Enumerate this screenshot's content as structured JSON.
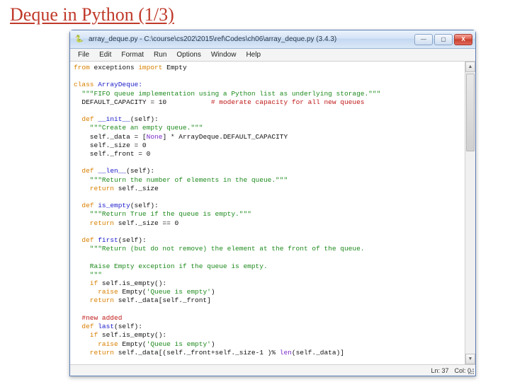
{
  "slide": {
    "title": "Deque in Python (1/3)"
  },
  "window": {
    "title": "array_deque.py - C:\\course\\cs202\\2015\\ref\\Codes\\ch06\\array_deque.py (3.4.3)",
    "buttons": {
      "min": "—",
      "max": "▢",
      "close": "X"
    }
  },
  "menu": {
    "items": [
      "File",
      "Edit",
      "Format",
      "Run",
      "Options",
      "Window",
      "Help"
    ]
  },
  "status": {
    "ln_label": "Ln: ",
    "ln": "37",
    "col_label": "Col: ",
    "col": "0"
  },
  "scroll": {
    "up": "▲",
    "down": "▼"
  },
  "code": {
    "l1a": "from",
    "l1b": " exceptions ",
    "l1c": "import",
    "l1d": " Empty",
    "l3a": "class",
    "l3b": " ArrayDeque:",
    "l4": "  \"\"\"FIFO queue implementation using a Python list as underlying storage.\"\"\"",
    "l5a": "  DEFAULT_CAPACITY = 10           ",
    "l5b": "# moderate capacity for all new queues",
    "l7a": "  def",
    "l7b": " __init__",
    "l7c": "(self):",
    "l8": "    \"\"\"Create an empty queue.\"\"\"",
    "l9a": "    self._data = [",
    "l9b": "None",
    "l9c": "] * ArrayDeque.DEFAULT_CAPACITY",
    "l10": "    self._size = 0",
    "l11": "    self._front = 0",
    "l13a": "  def",
    "l13b": " __len__",
    "l13c": "(self):",
    "l14": "    \"\"\"Return the number of elements in the queue.\"\"\"",
    "l15a": "    return",
    "l15b": " self._size",
    "l17a": "  def",
    "l17b": " is_empty",
    "l17c": "(self):",
    "l18": "    \"\"\"Return True if the queue is empty.\"\"\"",
    "l19a": "    return",
    "l19b": " self._size == 0",
    "l21a": "  def",
    "l21b": " first",
    "l21c": "(self):",
    "l22": "    \"\"\"Return (but do not remove) the element at the front of the queue.",
    "l23": "",
    "l24": "    Raise Empty exception if the queue is empty.",
    "l25": "    \"\"\"",
    "l26a": "    if",
    "l26b": " self.is_empty():",
    "l27a": "      raise",
    "l27b": " Empty(",
    "l27c": "'Queue is empty'",
    "l27d": ")",
    "l28a": "    return",
    "l28b": " self._data[self._front]",
    "l30": "  #new added",
    "l31a": "  def",
    "l31b": " last",
    "l31c": "(self):",
    "l32a": "    if",
    "l32b": " self.is_empty():",
    "l33a": "      raise",
    "l33b": " Empty(",
    "l33c": "'Queue is empty'",
    "l33d": ")",
    "l34a": "    return",
    "l34b": " self._data[(self._front+self._size-1 )% ",
    "l34c": "len",
    "l34d": "(self._data)]"
  }
}
